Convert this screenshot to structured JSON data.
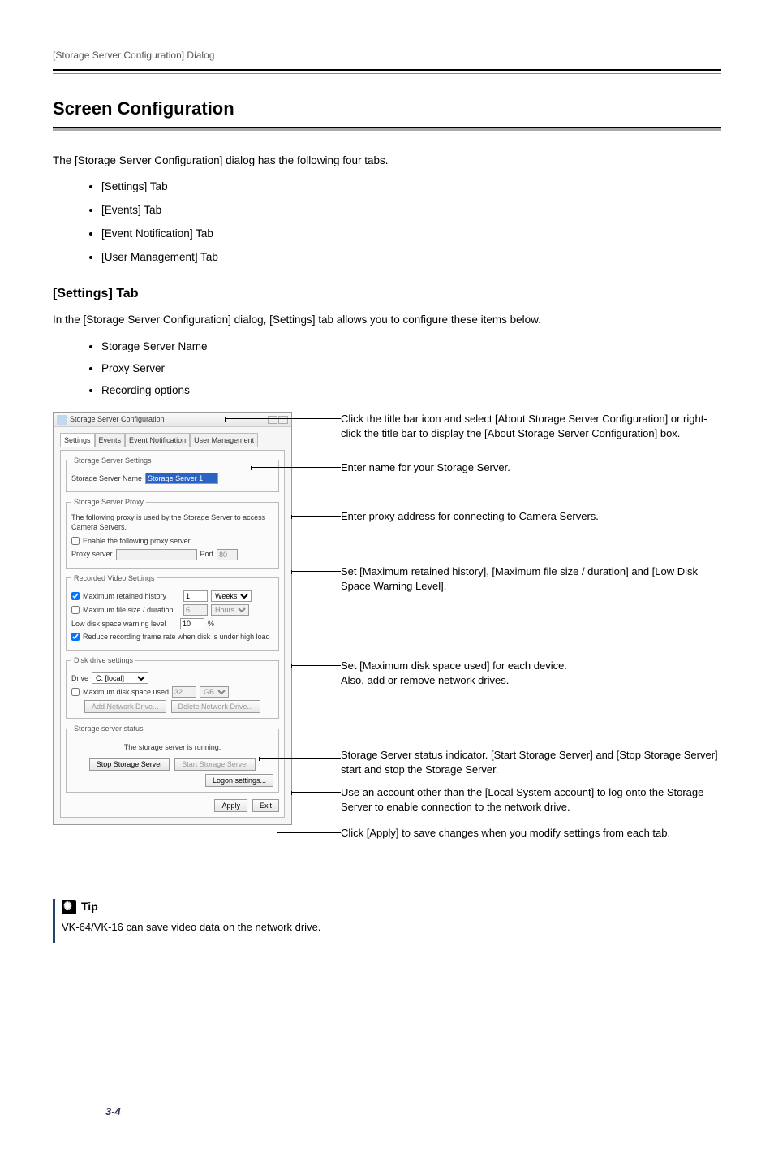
{
  "header": {
    "breadcrumb": "[Storage Server Configuration] Dialog"
  },
  "h1": "Screen Configuration",
  "intro": {
    "pre": "The [",
    "bold": "Storage Server Configuration",
    "post": "] dialog has the following four tabs."
  },
  "tabs_list": [
    {
      "pre": "[",
      "bold": "Settings",
      "post": "] Tab"
    },
    {
      "pre": "[",
      "bold": "Events",
      "post": "] Tab"
    },
    {
      "pre": "[",
      "bold": "Event Notification",
      "post": "] Tab"
    },
    {
      "pre": "[",
      "bold": "User Management",
      "post": "] Tab"
    }
  ],
  "h2": "[Settings] Tab",
  "intro2": {
    "pre": "In the [",
    "b1": "Storage Server Configuration",
    "mid": "] dialog, [",
    "b2": "Settings",
    "post": "] tab allows you to configure these items below."
  },
  "items_list": [
    "Storage Server Name",
    "Proxy Server",
    "Recording options"
  ],
  "dialog": {
    "title": "Storage Server Configuration",
    "tabs": [
      "Settings",
      "Events",
      "Event Notification",
      "User Management"
    ],
    "grp1": {
      "legend": "Storage Server Settings",
      "label": "Storage Server Name",
      "value": "Storage Server 1"
    },
    "grp2": {
      "legend": "Storage Server Proxy",
      "desc": "The following proxy is used by the Storage Server to access Camera Servers.",
      "enable": "Enable the following proxy server",
      "proxy_label": "Proxy server",
      "port_label": "Port",
      "port_value": "80"
    },
    "grp3": {
      "legend": "Recorded Video Settings",
      "r1": "Maximum retained history",
      "r1v": "1",
      "r1u": "Weeks",
      "r2": "Maximum file size / duration",
      "r2v": "6",
      "r2u": "Hours",
      "r3": "Low disk space warning level",
      "r3v": "10",
      "r3u": "%",
      "r4": "Reduce recording frame rate when disk is under high load"
    },
    "grp4": {
      "legend": "Disk drive settings",
      "drive_label": "Drive",
      "drive_value": "C: [local]",
      "max_label": "Maximum disk space used",
      "max_value": "32",
      "max_unit": "GB",
      "add_btn": "Add Network Drive...",
      "del_btn": "Delete Network Drive..."
    },
    "grp5": {
      "legend": "Storage server status",
      "status": "The storage server is running.",
      "stop_btn": "Stop Storage Server",
      "start_btn": "Start Storage Server",
      "logon_btn": "Logon settings..."
    },
    "apply_btn": "Apply",
    "exit_btn": "Exit"
  },
  "annos": {
    "a1": {
      "pre": "Click the title bar icon and select [",
      "b1": "About Storage Server Configuration",
      "mid": "] or right-click the title bar to display the [",
      "b2": "About Storage Server Configuration",
      "post": "] box."
    },
    "a2": "Enter name for your Storage Server.",
    "a3": "Enter proxy address for connecting to Camera Servers.",
    "a4": {
      "pre": "Set [",
      "b1": "Maximum retained history",
      "m1": "], [",
      "b2": "Maximum file size / duration",
      "m2": "] and [",
      "b3": "Low Disk Space Warning Level",
      "post": "]."
    },
    "a5": {
      "pre": "Set [",
      "b1": "Maximum disk space used",
      "post": "] for each device.",
      "line2": "Also, add or remove network drives."
    },
    "a6": {
      "pre": "Storage Server status indicator. [",
      "b1": "Start Storage Server",
      "m1": "] and [",
      "b2": "Stop Storage Server",
      "post": "] start and stop the Storage Server."
    },
    "a7": {
      "pre": "Use an account other than the [",
      "b1": "Local System account",
      "post": "] to log onto the Storage Server to enable connection to the network drive."
    },
    "a8": {
      "pre": "Click [",
      "b1": "Apply",
      "post": "] to save changes when you modify settings from each tab."
    }
  },
  "tip": {
    "label": "Tip",
    "text": "VK-64/VK-16 can save video data on the network drive."
  },
  "page_num": "3-4"
}
